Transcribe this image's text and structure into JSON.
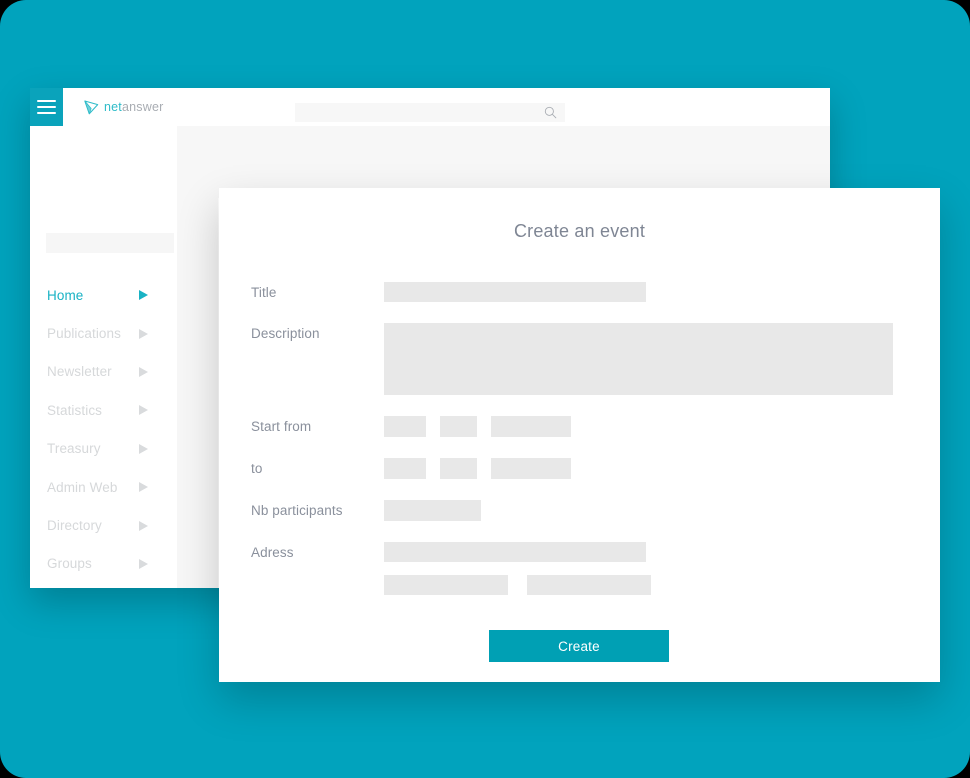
{
  "theme": {
    "background_teal": "#01a3bd",
    "accent_teal": "#00a0b4",
    "brand_teal": "#19b2c4",
    "label_gray": "#8a909c",
    "field_gray": "#e8e8e8",
    "page_gray": "#f7f7f7"
  },
  "app": {
    "header": {
      "menu_icon": "hamburger-icon",
      "logo": {
        "mark_icon": "paper-plane-icon",
        "text_primary": "net",
        "text_secondary": "answer"
      },
      "search": {
        "value": "",
        "placeholder": "",
        "icon": "search-icon"
      }
    },
    "sidebar": {
      "items": [
        {
          "label": "Home",
          "active": true,
          "caret_icon": "caret-right-icon"
        },
        {
          "label": "Publications",
          "active": false,
          "caret_icon": "caret-right-icon"
        },
        {
          "label": "Newsletter",
          "active": false,
          "caret_icon": "caret-right-icon"
        },
        {
          "label": "Statistics",
          "active": false,
          "caret_icon": "caret-right-icon"
        },
        {
          "label": "Treasury",
          "active": false,
          "caret_icon": "caret-right-icon"
        },
        {
          "label": "Admin Web",
          "active": false,
          "caret_icon": "caret-right-icon"
        },
        {
          "label": "Directory",
          "active": false,
          "caret_icon": "caret-right-icon"
        },
        {
          "label": "Groups",
          "active": false,
          "caret_icon": "caret-right-icon"
        }
      ]
    }
  },
  "modal": {
    "title": "Create an event",
    "fields": {
      "title": {
        "label": "Title",
        "value": "",
        "placeholder": ""
      },
      "description": {
        "label": "Description",
        "value": "",
        "placeholder": ""
      },
      "start_from": {
        "label": "Start from",
        "day": "",
        "month": "",
        "time": ""
      },
      "to": {
        "label": "to",
        "day": "",
        "month": "",
        "time": ""
      },
      "nb_participants": {
        "label": "Nb participants",
        "value": "",
        "placeholder": ""
      },
      "adress": {
        "label": "Adress",
        "value": "",
        "placeholder": ""
      },
      "adress_city": {
        "value": "",
        "placeholder": ""
      },
      "adress_zip": {
        "value": "",
        "placeholder": ""
      }
    },
    "submit_label": "Create"
  }
}
